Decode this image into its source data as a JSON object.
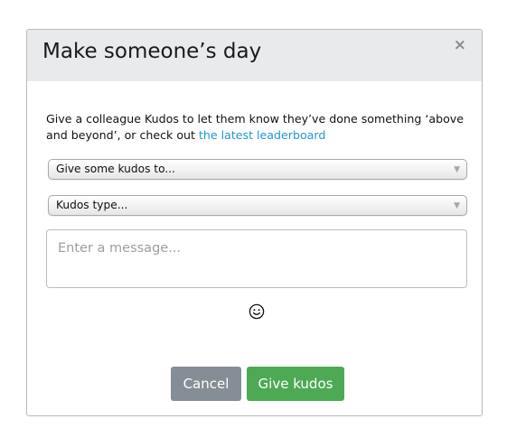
{
  "dialog": {
    "title": "Make someone’s day",
    "close_label": "×",
    "intro_text": "Give a colleague Kudos to let them know they’ve done something ‘above and beyond’, or check out ",
    "leaderboard_link": "the latest leaderboard",
    "recipient_select": {
      "selected": "Give some kudos to...",
      "arrow": "▼"
    },
    "type_select": {
      "selected": "Kudos type...",
      "arrow": "▼"
    },
    "message": {
      "placeholder": "Enter a message...",
      "value": ""
    },
    "emoji_icon": "smiley-face-icon",
    "buttons": {
      "cancel": "Cancel",
      "give": "Give kudos"
    }
  },
  "colors": {
    "header_bg": "#e9eaec",
    "link": "#1f96d6",
    "cancel_bg": "#858e96",
    "give_bg": "#4ea955"
  }
}
